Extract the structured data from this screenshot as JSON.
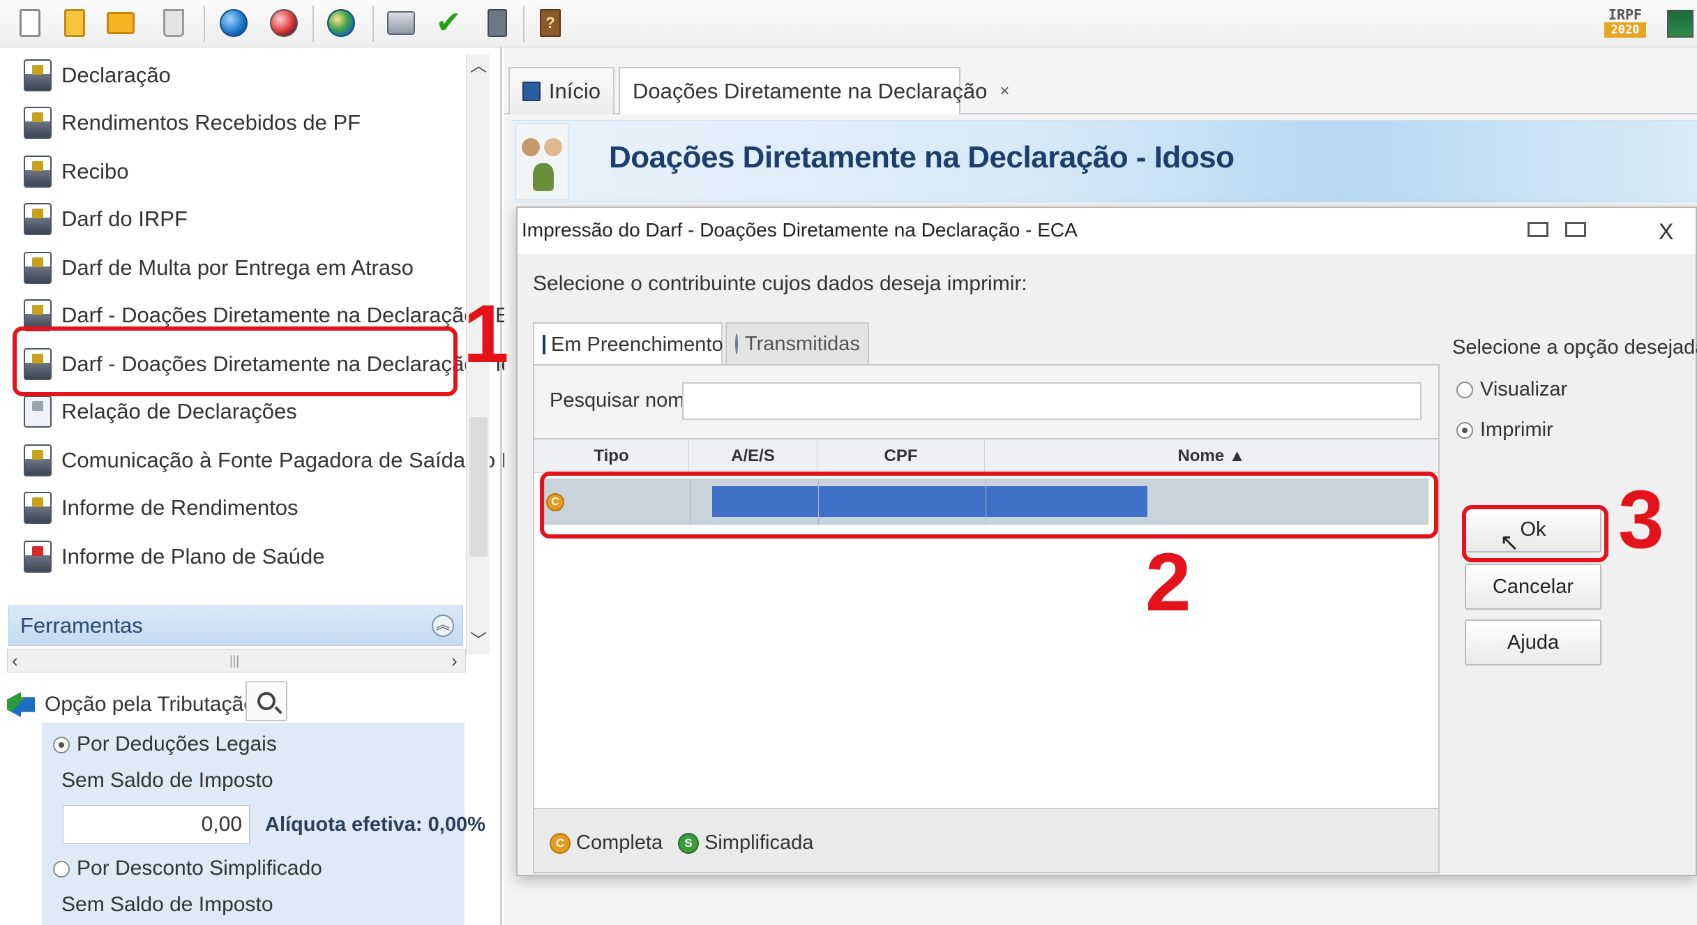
{
  "toolbar": {
    "icons": [
      "new-document-icon",
      "open-document-icon",
      "folder-icon",
      "trash-icon",
      "transmit-globe-icon",
      "receipt-globe-icon",
      "earth-globe-icon",
      "printer-icon",
      "check-icon",
      "calculator-icon",
      "help-book-icon"
    ],
    "irpf_badge": "IRPF",
    "irpf_year": "2020"
  },
  "sidebar": {
    "items": [
      {
        "label": "Declaração",
        "icon": "printer-doc-icon"
      },
      {
        "label": "Rendimentos Recebidos de PF",
        "icon": "printer-doc-icon"
      },
      {
        "label": "Recibo",
        "icon": "printer-doc-icon"
      },
      {
        "label": "Darf do IRPF",
        "icon": "printer-doc-icon"
      },
      {
        "label": "Darf de Multa por Entrega em Atraso",
        "icon": "printer-doc-icon"
      },
      {
        "label": "Darf - Doações Diretamente na Declaração - ECA",
        "icon": "printer-doc-icon"
      },
      {
        "label": "Darf - Doações Diretamente na Declaração - Idoso",
        "icon": "printer-doc-icon"
      },
      {
        "label": "Relação de Declarações",
        "icon": "list-doc-icon"
      },
      {
        "label": "Comunicação à Fonte Pagadora de Saída do País",
        "icon": "printer-doc-icon"
      },
      {
        "label": "Informe de Rendimentos",
        "icon": "printer-doc-icon"
      },
      {
        "label": "Informe de Plano de Saúde",
        "icon": "health-doc-icon"
      }
    ],
    "tools_header": "Ferramentas",
    "tax_option": {
      "label": "Opção pela Tributação:",
      "legal_deductions": "Por Deduções Legais",
      "legal_status": "Sem Saldo de Imposto",
      "value": "0,00",
      "aliquota": "Alíquota efetiva: 0,00%",
      "simplified_discount": "Por Desconto Simplificado",
      "simplified_status": "Sem Saldo de Imposto"
    }
  },
  "tabs": [
    {
      "label": "Início"
    },
    {
      "label": "Doações Diretamente na Declaração",
      "close": "×"
    }
  ],
  "header": {
    "title": "Doações Diretamente na Declaração - Idoso"
  },
  "dialog": {
    "title": "Impressão do Darf - Doações Diretamente na Declaração - ECA",
    "close": "X",
    "prompt": "Selecione o contribuinte cujos dados deseja imprimir:",
    "tabs": [
      "Em Preenchimento",
      "Transmitidas"
    ],
    "search_label": "Pesquisar nome:",
    "search_value": "",
    "columns": [
      "Tipo",
      "A/E/S",
      "CPF",
      "Nome ▲"
    ],
    "row_badge": "C",
    "legend": {
      "complete_badge": "C",
      "complete": "Completa",
      "simplified_badge": "S",
      "simplified": "Simplificada"
    },
    "options_label": "Selecione a opção desejada:",
    "options": [
      "Visualizar",
      "Imprimir"
    ],
    "selected_option": "Imprimir",
    "buttons": {
      "ok": "Ok",
      "cancel": "Cancelar",
      "help": "Ajuda"
    }
  },
  "annotations": {
    "step1": "1",
    "step2": "2",
    "step3": "3",
    "color": "#e4131b"
  }
}
